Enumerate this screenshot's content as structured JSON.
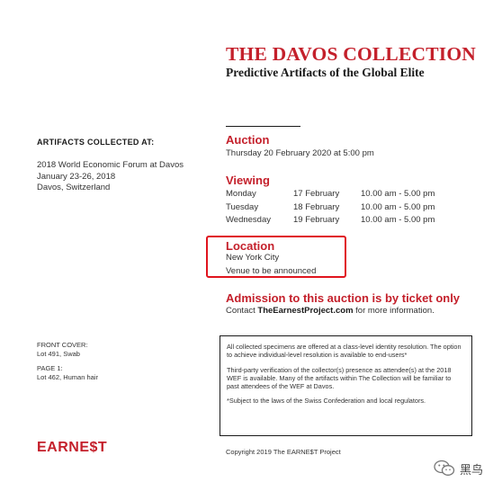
{
  "header": {
    "title": "THE DAVOS COLLECTION",
    "subtitle": "Predictive Artifacts of the Global Elite"
  },
  "artifacts": {
    "heading": "ARTIFACTS COLLECTED AT:",
    "lines": [
      "2018 World Economic Forum at Davos",
      "January 23-26, 2018",
      "Davos, Switzerland"
    ]
  },
  "auction": {
    "heading": "Auction",
    "date": "Thursday 20 February 2020 at 5:00 pm"
  },
  "viewing": {
    "heading": "Viewing",
    "rows": [
      {
        "day": "Monday",
        "date": "17 February",
        "time": "10.00 am - 5.00 pm"
      },
      {
        "day": "Tuesday",
        "date": "18 February",
        "time": "10.00 am - 5.00 pm"
      },
      {
        "day": "Wednesday",
        "date": "19 February",
        "time": "10.00 am - 5.00 pm"
      }
    ]
  },
  "location": {
    "heading": "Location",
    "city": "New York City",
    "venue": "Venue to be announced",
    "highlight_color": "#e0141e"
  },
  "admission": {
    "heading": "Admission to this auction is by ticket only",
    "contact_prefix": "Contact ",
    "contact_link": "TheEarnestProject.com",
    "contact_suffix": " for more information."
  },
  "cover": {
    "front_label": "FRONT COVER:",
    "front_value": "Lot 491, Swab",
    "page_label": "PAGE 1:",
    "page_value": "Lot 462, Human hair"
  },
  "notice": {
    "para1": "All collected specimens are offered at a class-level identity resolution. The option to achieve individual-level resolution is available to end-users*",
    "para2": "Third-party verification of the collector(s) presence as attendee(s) at the 2018 WEF is available.  Many of the artifacts within The Collection will be familiar to past attendees of the WEF at Davos.",
    "para3": "*Subject to the laws of the Swiss Confederation and local regulators."
  },
  "footer": {
    "logo": "EARNE$T",
    "copyright": "Copyright 2019 The EARNE$T Project"
  },
  "watermark": {
    "icon": "wechat-icon",
    "text": "黑鸟"
  },
  "colors": {
    "accent_red": "#c4202b",
    "text": "#1a1a1a"
  }
}
